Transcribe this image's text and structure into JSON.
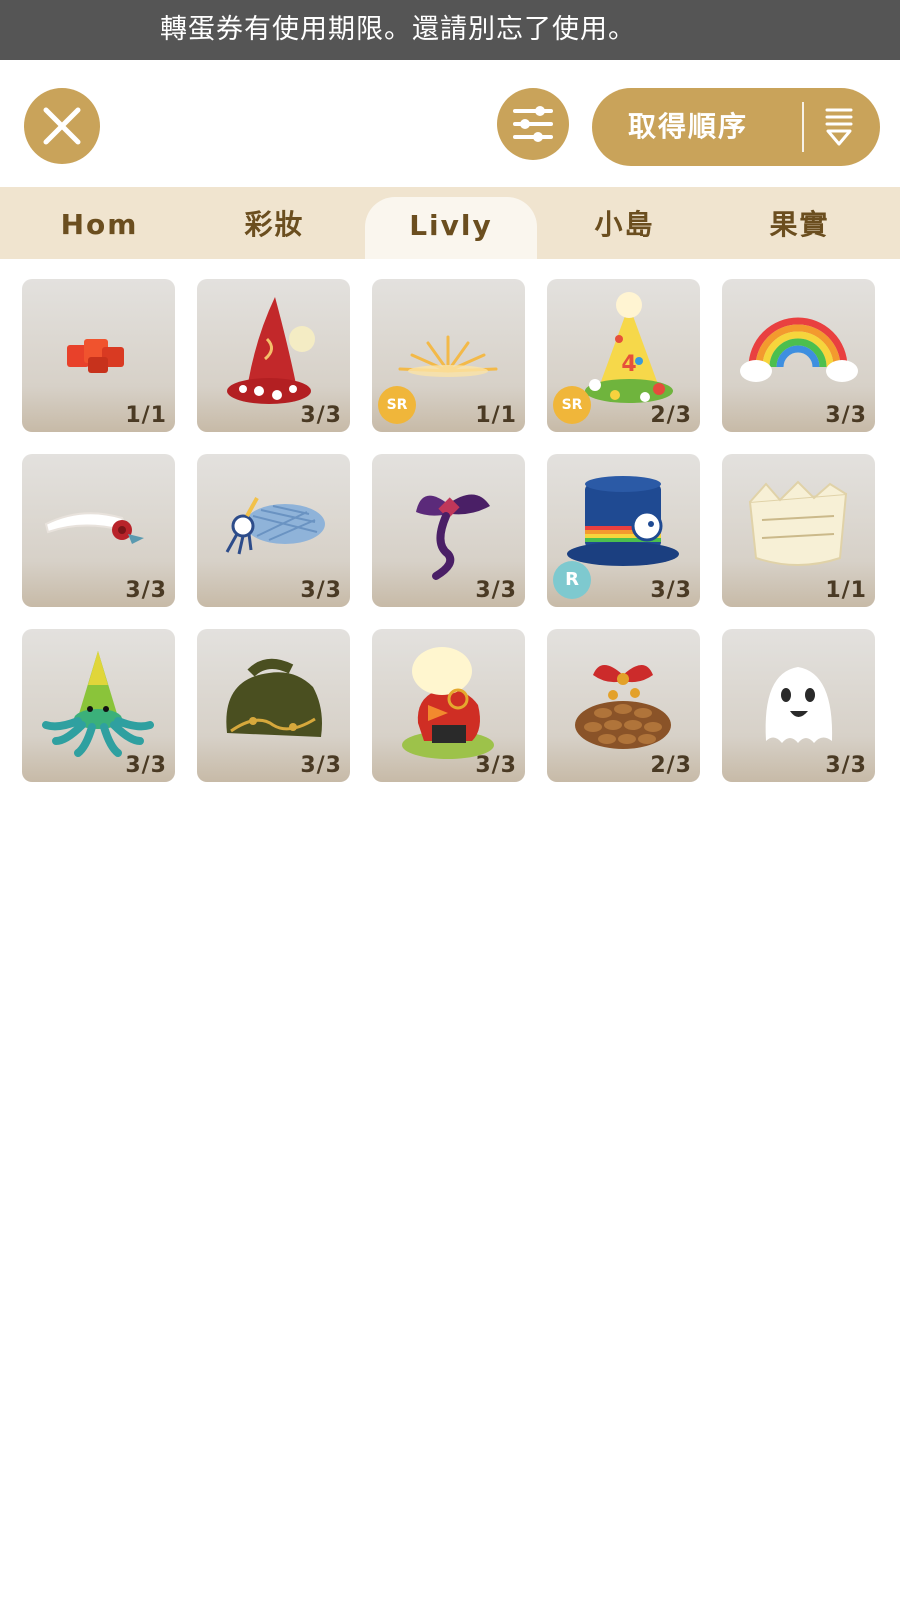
{
  "notice": "轉蛋券有使用期限。還請別忘了使用。",
  "toolbar": {
    "sort_label": "取得順序"
  },
  "tabs": [
    {
      "label": "Hom",
      "active": false
    },
    {
      "label": "彩妝",
      "active": false
    },
    {
      "label": "Livly",
      "active": true
    },
    {
      "label": "小島",
      "active": false
    },
    {
      "label": "果實",
      "active": false
    }
  ],
  "items": [
    {
      "icon": "red-gems-icon",
      "count": "1/1",
      "badge": ""
    },
    {
      "icon": "red-witch-hat-icon",
      "count": "3/3",
      "badge": ""
    },
    {
      "icon": "golden-sparkle-icon",
      "count": "1/1",
      "badge": "SR"
    },
    {
      "icon": "birthday-party-hat-icon",
      "count": "2/3",
      "badge": "SR"
    },
    {
      "icon": "rainbow-cloud-icon",
      "count": "3/3",
      "badge": ""
    },
    {
      "icon": "white-headband-flower-icon",
      "count": "3/3",
      "badge": ""
    },
    {
      "icon": "blue-plaid-beret-icon",
      "count": "3/3",
      "badge": ""
    },
    {
      "icon": "purple-ribbon-bow-icon",
      "count": "3/3",
      "badge": ""
    },
    {
      "icon": "rainbow-top-hat-icon",
      "count": "3/3",
      "badge": "R"
    },
    {
      "icon": "ticket-crown-icon",
      "count": "1/1",
      "badge": ""
    },
    {
      "icon": "green-octopus-hat-icon",
      "count": "3/3",
      "badge": ""
    },
    {
      "icon": "olive-knit-cap-icon",
      "count": "3/3",
      "badge": ""
    },
    {
      "icon": "bird-costume-icon",
      "count": "3/3",
      "badge": ""
    },
    {
      "icon": "pinecone-bow-icon",
      "count": "2/3",
      "badge": ""
    },
    {
      "icon": "ghost-icon",
      "count": "3/3",
      "badge": ""
    }
  ],
  "colors": {
    "accent": "#c9a35a",
    "tab_text": "#6b4e1f",
    "tabbar_bg": "#f0e4cf",
    "notice_bg": "#555555"
  }
}
